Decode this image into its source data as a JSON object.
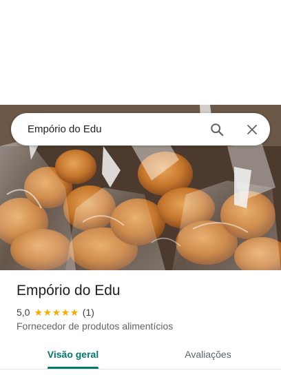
{
  "search": {
    "query": "Empório do Edu"
  },
  "place": {
    "name": "Empório do Edu",
    "rating": "5,0",
    "stars": 5,
    "review_count": "(1)",
    "category": "Fornecedor de produtos alimentícios"
  },
  "tabs": [
    {
      "label": "Visão geral",
      "active": true
    },
    {
      "label": "Avaliações",
      "active": false
    }
  ],
  "icons": {
    "search": "search-icon",
    "close": "close-icon",
    "star": "star-icon"
  },
  "colors": {
    "accent": "#00796b",
    "star": "#f9ab00"
  }
}
